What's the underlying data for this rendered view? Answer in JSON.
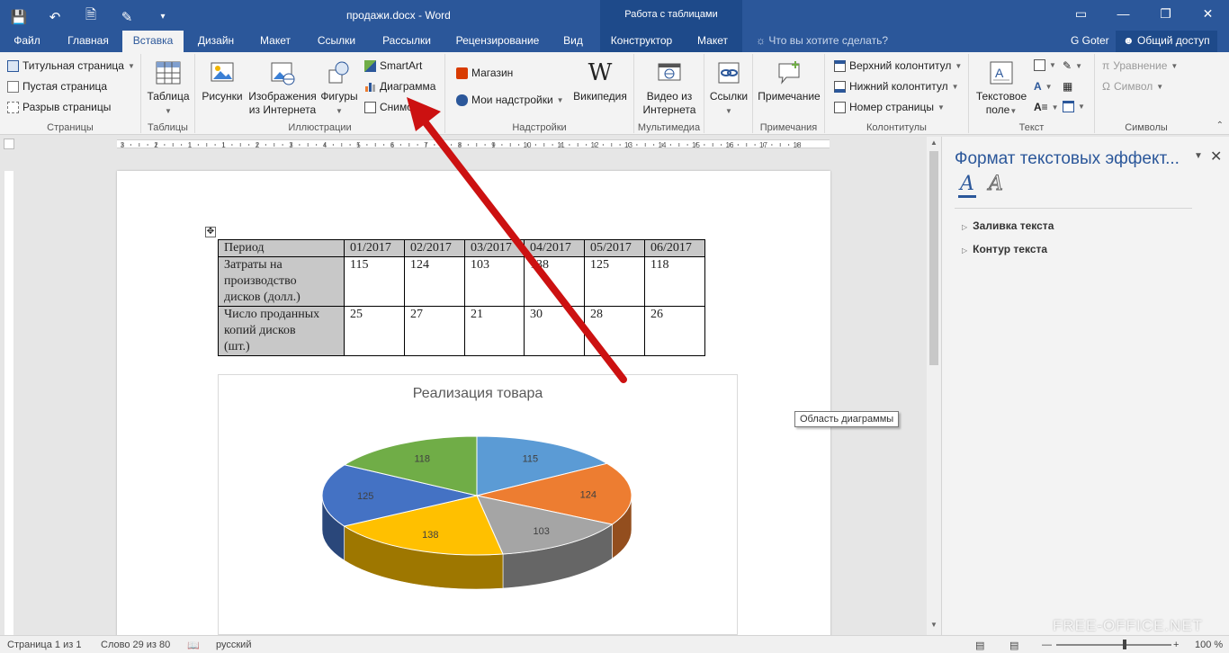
{
  "window": {
    "title": "продажи.docx - Word",
    "context_title": "Работа с таблицами",
    "accent": "#2b579a"
  },
  "qat": {
    "icons": [
      "save-icon",
      "undo-icon",
      "new-document-icon",
      "touch-mode-icon",
      "customize-qat-icon"
    ]
  },
  "tabs": [
    {
      "label": "Файл"
    },
    {
      "label": "Главная"
    },
    {
      "label": "Вставка",
      "active": true
    },
    {
      "label": "Дизайн"
    },
    {
      "label": "Макет"
    },
    {
      "label": "Ссылки"
    },
    {
      "label": "Рассылки"
    },
    {
      "label": "Рецензирование"
    },
    {
      "label": "Вид"
    },
    {
      "label": "Конструктор",
      "contextual": true
    },
    {
      "label": "Макет",
      "contextual": true
    }
  ],
  "tellme": "Что вы хотите сделать?",
  "user": "G Goter",
  "share": "Общий доступ",
  "ribbon": {
    "pages": {
      "label": "Страницы",
      "items": [
        "Титульная страница",
        "Пустая страница",
        "Разрыв страницы"
      ]
    },
    "tables": {
      "label": "Таблицы",
      "table": "Таблица"
    },
    "illustrations": {
      "label": "Иллюстрации",
      "pictures": "Рисунки",
      "online_line1": "Изображения",
      "online_line2": "из Интернета",
      "shapes": "Фигуры",
      "smartart": "SmartArt",
      "chart": "Диаграмма",
      "screenshot": "Снимок"
    },
    "addins": {
      "label": "Надстройки",
      "store": "Магазин",
      "my_addins": "Мои надстройки",
      "wikipedia": "Википедия"
    },
    "media": {
      "label": "Мультимедиа",
      "video_line1": "Видео из",
      "video_line2": "Интернета"
    },
    "links": {
      "label": "Ссылки"
    },
    "comments": {
      "label": "Примечания",
      "comment": "Примечание"
    },
    "header_footer": {
      "label": "Колонтитулы",
      "items": [
        "Верхний колонтитул",
        "Нижний колонтитул",
        "Номер страницы"
      ]
    },
    "text": {
      "label": "Текст",
      "textbox_line1": "Текстовое",
      "textbox_line2": "поле"
    },
    "symbols": {
      "label": "Символы",
      "equation": "Уравнение",
      "symbol": "Символ"
    }
  },
  "ruler_marks": [
    "3",
    "2",
    "1",
    "1",
    "2",
    "3",
    "4",
    "5",
    "6",
    "7",
    "8",
    "9",
    "10",
    "11",
    "12",
    "13",
    "14",
    "15",
    "16",
    "17",
    "18"
  ],
  "table": {
    "header": [
      "Период",
      "01/2017",
      "02/2017",
      "03/2017",
      "04/2017",
      "05/2017",
      "06/2017"
    ],
    "rows": [
      {
        "label_lines": [
          "Затраты на",
          "производство",
          "дисков (долл.)"
        ],
        "values": [
          "115",
          "124",
          "103",
          "138",
          "125",
          "118"
        ]
      },
      {
        "label_lines": [
          "Число проданных",
          "копий дисков",
          "(шт.)"
        ],
        "values": [
          "25",
          "27",
          "21",
          "30",
          "28",
          "26"
        ]
      }
    ]
  },
  "chart_data": {
    "type": "pie",
    "title": "Реализация товара",
    "labels": [
      "115",
      "124",
      "103",
      "138",
      "125",
      "118"
    ],
    "values": [
      115,
      124,
      103,
      138,
      125,
      118
    ],
    "colors": [
      "#5b9bd5",
      "#ed7d31",
      "#a5a5a5",
      "#ffc000",
      "#4472c4",
      "#70ad47"
    ],
    "legend": "none"
  },
  "tooltip": "Область диаграммы",
  "pane": {
    "title": "Формат текстовых эффект...",
    "sections": [
      "Заливка текста",
      "Контур текста"
    ]
  },
  "status": {
    "page": "Страница 1 из 1",
    "words": "Слово 29 из 80",
    "language": "русский",
    "zoom": "100 %"
  },
  "watermark": "FREE-OFFICE.NET"
}
